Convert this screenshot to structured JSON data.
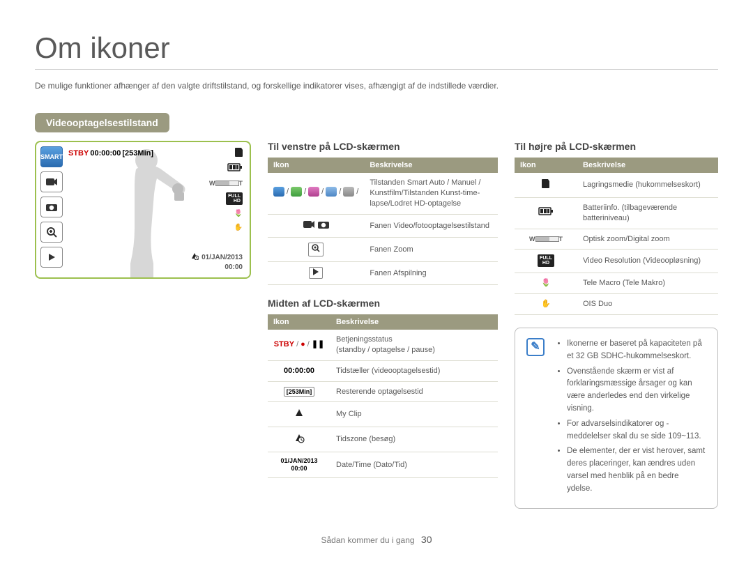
{
  "title": "Om ikoner",
  "intro": "De mulige funktioner afhænger af den valgte driftstilstand, og forskellige indikatorer vises, afhængigt af de indstillede værdier.",
  "section": "Videooptagelsestilstand",
  "lcd": {
    "stby": "STBY",
    "time": "00:00:00",
    "remain": "[253Min]",
    "date": "01/JAN/2013",
    "clock": "00:00",
    "card_glyph": "🂠",
    "battery_glyph": "▮▮▮",
    "zoom_w": "W",
    "zoom_t": "T",
    "fullhd": "FULL HD",
    "tele": "🌷",
    "ois": "✋"
  },
  "tables": {
    "left": {
      "heading": "Til venstre på LCD-skærmen",
      "col_icon": "Ikon",
      "col_desc": "Beskrivelse",
      "rows": [
        {
          "icon": "modes",
          "desc": "Tilstanden Smart Auto / Manuel / Kunstfilm/Tilstanden Kunst-time-lapse/Lodret HD-optagelse"
        },
        {
          "icon": "fanen",
          "desc": "Fanen Video/fotooptagelsestilstand"
        },
        {
          "icon": "zoom",
          "desc": "Fanen Zoom"
        },
        {
          "icon": "play",
          "desc": "Fanen Afspilning"
        }
      ]
    },
    "mid": {
      "heading": "Midten af LCD-skærmen",
      "col_icon": "Ikon",
      "col_desc": "Beskrivelse",
      "rows": [
        {
          "icon": "stby",
          "desc_b": "Betjeningsstatus",
          "desc": "(standby / optagelse / pause)"
        },
        {
          "icon": "00:00:00",
          "desc": "Tidstæller (videooptagelsestid)"
        },
        {
          "icon": "[253Min]",
          "desc": "Resterende optagelsestid"
        },
        {
          "icon": "myclip",
          "desc": "My Clip"
        },
        {
          "icon": "tz",
          "desc": "Tidszone (besøg)"
        },
        {
          "icon": "01/JAN/2013\n00:00",
          "desc": "Date/Time (Dato/Tid)"
        }
      ]
    },
    "right": {
      "heading": "Til højre på LCD-skærmen",
      "col_icon": "Ikon",
      "col_desc": "Beskrivelse",
      "rows": [
        {
          "icon": "card",
          "desc": "Lagringsmedie (hukommelseskort)"
        },
        {
          "icon": "batt",
          "desc": "Batteriinfo. (tilbageværende batteriniveau)"
        },
        {
          "icon": "zoombar",
          "desc": "Optisk zoom/Digital zoom"
        },
        {
          "icon": "fullhd",
          "desc": "Video Resolution (Videoopløsning)"
        },
        {
          "icon": "tele",
          "desc": "Tele Macro (Tele Makro)"
        },
        {
          "icon": "ois",
          "desc": "OIS Duo"
        }
      ]
    }
  },
  "note": {
    "items": [
      "Ikonerne er baseret på kapaciteten på et 32 GB SDHC-hukommelseskort.",
      "Ovenstående skærm er vist af forklaringsmæssige årsager og kan være anderledes end den virkelige visning.",
      "For advarselsindikatorer og -meddelelser skal du se side 109~113.",
      "De elementer, der er vist herover, samt deres placeringer, kan ændres uden varsel med henblik på en bedre ydelse."
    ]
  },
  "footer": {
    "text": "Sådan kommer du i gang",
    "page": "30"
  }
}
